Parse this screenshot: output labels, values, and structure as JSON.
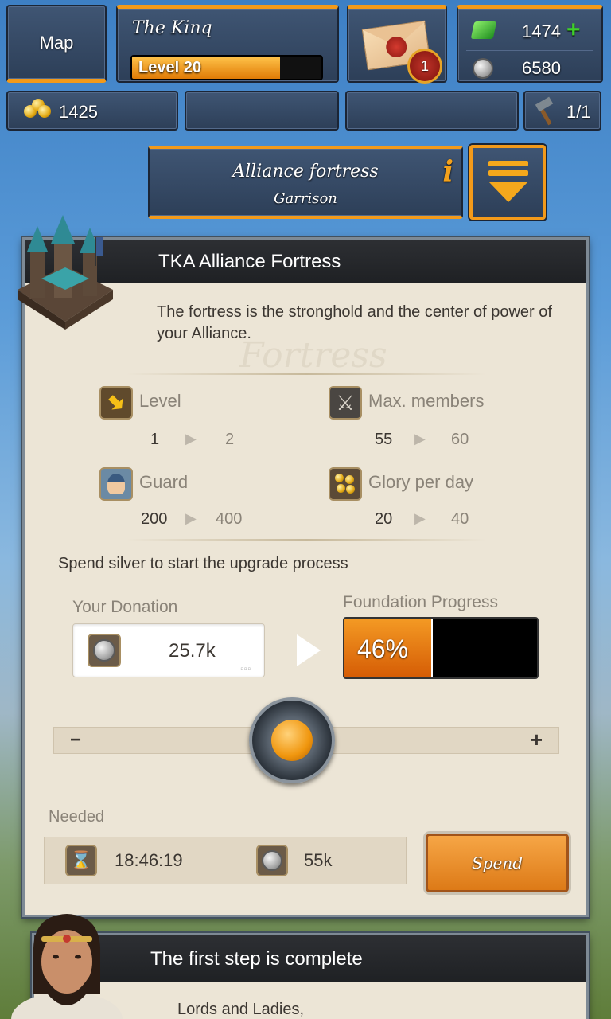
{
  "topbar": {
    "map_label": "Map",
    "player_name": "The Kinq",
    "level_label": "Level 20",
    "level_progress": 0.78,
    "mail_count": "1",
    "gems": "1474",
    "silver": "6580",
    "gold": "1425",
    "builders": "1/1"
  },
  "location": {
    "title": "Alliance fortress",
    "subtitle": "Garrison",
    "info_glyph": "i"
  },
  "fortress": {
    "header": "TKA Alliance Fortress",
    "description": "The fortress is the stronghold and the center of power of your Alliance.",
    "watermark": "Fortress",
    "stats": [
      {
        "label": "Level",
        "from": "1",
        "to": "2",
        "icon": "level-up-icon"
      },
      {
        "label": "Max. members",
        "from": "55",
        "to": "60",
        "icon": "crossed-swords-icon"
      },
      {
        "label": "Guard",
        "from": "200",
        "to": "400",
        "icon": "guard-icon"
      },
      {
        "label": "Glory per day",
        "from": "20",
        "to": "40",
        "icon": "glory-icon"
      }
    ],
    "spend_prompt": "Spend silver to start the upgrade process",
    "donation_label": "Your Donation",
    "donation_value": "25.7k",
    "progress_label": "Foundation Progress",
    "progress_text": "46%",
    "progress_value": 0.46,
    "slider_value": 0.47,
    "minus": "−",
    "plus": "+",
    "needed_label": "Needed",
    "needed_time": "18:46:19",
    "needed_silver": "55k",
    "spend_button": "Spend"
  },
  "message": {
    "header": "The first step is complete",
    "body": "Lords and Ladies,"
  },
  "colors": {
    "accent_orange": "#f39a1a",
    "panel_navy": "#34486a",
    "card_bg": "#ece5d6"
  }
}
